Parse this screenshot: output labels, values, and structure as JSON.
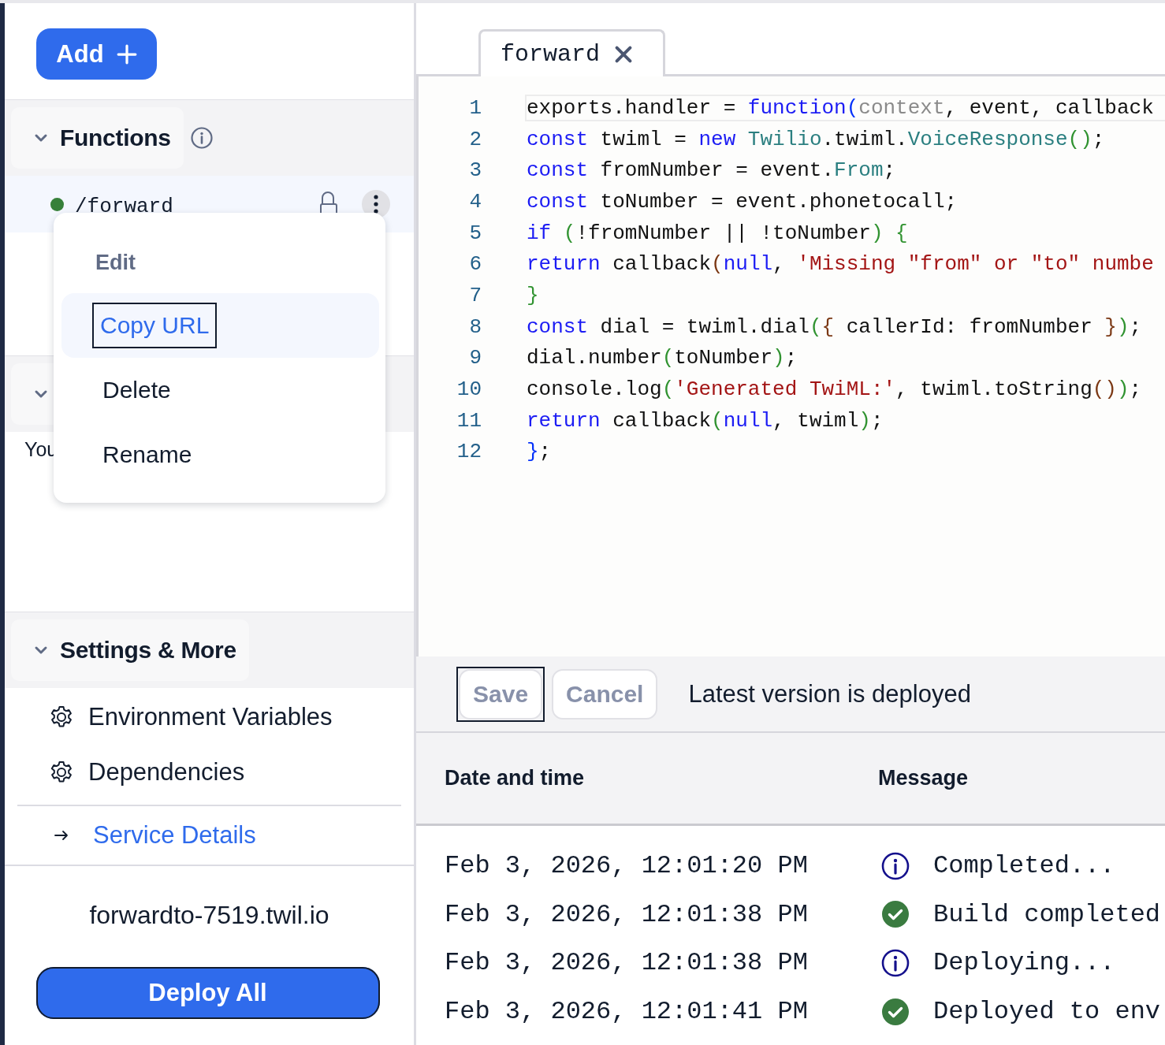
{
  "sidebar": {
    "add_button": {
      "label": "Add"
    },
    "sections": [
      {
        "title": "Functions",
        "expanded": true,
        "info": true,
        "items": [
          {
            "path": "/forward",
            "color": "#37803a",
            "protected": true,
            "menu_open": true
          }
        ]
      },
      {
        "expanded": true,
        "text": "You"
      },
      {
        "title": "Settings & More",
        "expanded": true,
        "items": [
          {
            "kind": "setting",
            "label": "Environment Variables"
          },
          {
            "kind": "setting",
            "label": "Dependencies"
          },
          {
            "kind": "link",
            "label": "Service Details"
          }
        ]
      }
    ],
    "domain": "forwardto-7519.twil.io",
    "deploy_button": {
      "label": "Deploy All",
      "focused": true
    }
  },
  "context_menu": [
    {
      "label": "Edit",
      "disabled": true,
      "selected": false
    },
    {
      "label": "Copy URL",
      "disabled": false,
      "selected": true
    },
    {
      "label": "Delete",
      "disabled": false,
      "selected": false
    },
    {
      "label": "Rename",
      "disabled": false,
      "selected": false
    }
  ],
  "editor": {
    "tabs": [
      {
        "label": "forward",
        "selected": true
      }
    ],
    "lines": [
      {
        "number": "1",
        "active": true,
        "tokens": [
          {
            "text": "exports.handler = ",
            "kind": "plain"
          },
          {
            "text": "function",
            "kind": "keyword"
          },
          {
            "text": "(",
            "kind": "bracket3"
          },
          {
            "text": "context",
            "kind": "param"
          },
          {
            "text": ", event, callback",
            "kind": "plain"
          }
        ]
      },
      {
        "number": "2",
        "active": false,
        "tokens": [
          {
            "text": "const",
            "kind": "keyword"
          },
          {
            "text": " twiml = ",
            "kind": "plain"
          },
          {
            "text": "new",
            "kind": "keyword"
          },
          {
            "text": " Twilio",
            "kind": "type"
          },
          {
            "text": ".twiml.",
            "kind": "plain"
          },
          {
            "text": "VoiceResponse",
            "kind": "type"
          },
          {
            "text": "()",
            "kind": "bracket1"
          },
          {
            "text": ";",
            "kind": "plain"
          }
        ]
      },
      {
        "number": "3",
        "active": false,
        "tokens": [
          {
            "text": "const",
            "kind": "keyword"
          },
          {
            "text": " fromNumber = event.",
            "kind": "plain"
          },
          {
            "text": "From",
            "kind": "type"
          },
          {
            "text": ";",
            "kind": "plain"
          }
        ]
      },
      {
        "number": "4",
        "active": false,
        "tokens": [
          {
            "text": "const",
            "kind": "keyword"
          },
          {
            "text": " toNumber = event.phonetocall;",
            "kind": "plain"
          }
        ]
      },
      {
        "number": "5",
        "active": false,
        "tokens": [
          {
            "text": "if",
            "kind": "keyword"
          },
          {
            "text": " (",
            "kind": "bracket1"
          },
          {
            "text": "!fromNumber || !toNumber",
            "kind": "plain"
          },
          {
            "text": ") {",
            "kind": "bracket1"
          }
        ]
      },
      {
        "number": "6",
        "active": false,
        "tokens": [
          {
            "text": "return",
            "kind": "keyword"
          },
          {
            "text": " callback",
            "kind": "plain"
          },
          {
            "text": "(",
            "kind": "bracket2"
          },
          {
            "text": "null",
            "kind": "keyword"
          },
          {
            "text": ", ",
            "kind": "plain"
          },
          {
            "text": "'Missing \"from\" or \"to\" numbe",
            "kind": "string"
          }
        ]
      },
      {
        "number": "7",
        "active": false,
        "tokens": [
          {
            "text": "}",
            "kind": "bracket1"
          }
        ]
      },
      {
        "number": "8",
        "active": false,
        "tokens": [
          {
            "text": "const",
            "kind": "keyword"
          },
          {
            "text": " dial = twiml.dial",
            "kind": "plain"
          },
          {
            "text": "(",
            "kind": "bracket1"
          },
          {
            "text": "{",
            "kind": "bracket2"
          },
          {
            "text": " callerId: fromNumber ",
            "kind": "plain"
          },
          {
            "text": "}",
            "kind": "bracket2"
          },
          {
            "text": ")",
            "kind": "bracket1"
          },
          {
            "text": ";",
            "kind": "plain"
          }
        ]
      },
      {
        "number": "9",
        "active": false,
        "tokens": [
          {
            "text": "dial.number",
            "kind": "plain"
          },
          {
            "text": "(",
            "kind": "bracket1"
          },
          {
            "text": "toNumber",
            "kind": "plain"
          },
          {
            "text": ")",
            "kind": "bracket1"
          },
          {
            "text": ";",
            "kind": "plain"
          }
        ]
      },
      {
        "number": "10",
        "active": false,
        "tokens": [
          {
            "text": "console.log",
            "kind": "plain"
          },
          {
            "text": "(",
            "kind": "bracket1"
          },
          {
            "text": "'Generated TwiML:'",
            "kind": "string"
          },
          {
            "text": ", twiml.toString",
            "kind": "plain"
          },
          {
            "text": "()",
            "kind": "bracket2"
          },
          {
            "text": ")",
            "kind": "bracket1"
          },
          {
            "text": ";",
            "kind": "plain"
          }
        ]
      },
      {
        "number": "11",
        "active": false,
        "tokens": [
          {
            "text": "return",
            "kind": "keyword"
          },
          {
            "text": " callback",
            "kind": "plain"
          },
          {
            "text": "(",
            "kind": "bracket1"
          },
          {
            "text": "null",
            "kind": "keyword"
          },
          {
            "text": ", twiml",
            "kind": "plain"
          },
          {
            "text": ")",
            "kind": "bracket1"
          },
          {
            "text": ";",
            "kind": "plain"
          }
        ]
      },
      {
        "number": "12",
        "active": false,
        "tokens": [
          {
            "text": "}",
            "kind": "bracket3"
          },
          {
            "text": ";",
            "kind": "plain"
          }
        ]
      }
    ]
  },
  "toolbar": {
    "buttons": [
      {
        "label": "Save",
        "disabled": true,
        "focused": true
      },
      {
        "label": "Cancel",
        "disabled": true,
        "focused": false
      }
    ],
    "status": "Latest version is deployed"
  },
  "logs": {
    "columns": [
      "Date and time",
      "Message"
    ],
    "rows": [
      {
        "time": "Feb 3, 2026, 12:01:20 PM",
        "kind": "info",
        "message": "Completed..."
      },
      {
        "time": "Feb 3, 2026, 12:01:38 PM",
        "kind": "success",
        "message": "Build completed"
      },
      {
        "time": "Feb 3, 2026, 12:01:38 PM",
        "kind": "info",
        "message": "Deploying..."
      },
      {
        "time": "Feb 3, 2026, 12:01:41 PM",
        "kind": "success",
        "message": "Deployed to env"
      }
    ]
  }
}
